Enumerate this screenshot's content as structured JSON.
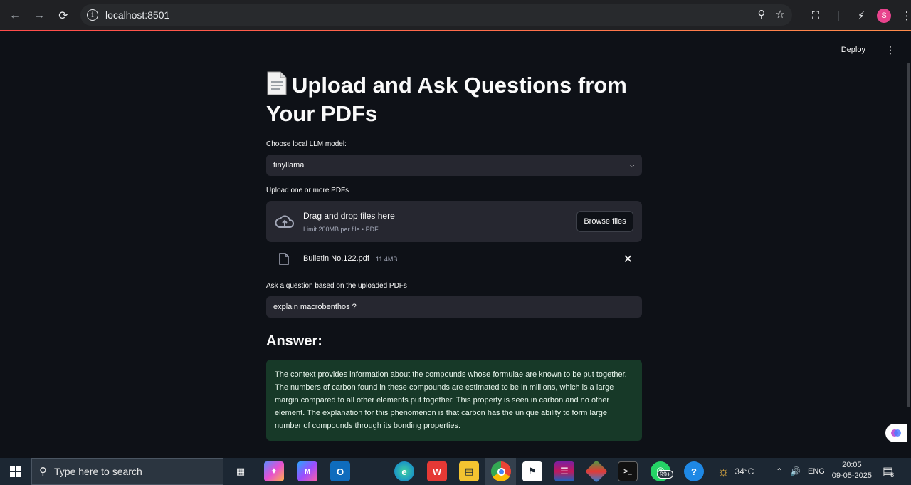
{
  "browser": {
    "url": "localhost:8501",
    "avatar_letter": "S",
    "icons": [
      "back-icon",
      "forward-icon",
      "reload-icon",
      "site-info-icon",
      "zoom-icon",
      "bookmark-star-icon",
      "extensions-icon",
      "performance-icon",
      "kebab-menu-icon"
    ]
  },
  "header": {
    "deploy_label": "Deploy",
    "menu_icon": "⋮"
  },
  "page": {
    "title_line1": "Upload and Ask Questions from",
    "title_line2": "Your PDFs",
    "model_label": "Choose local LLM model:",
    "model_value": "tinyllama",
    "upload_label": "Upload one or more PDFs",
    "dropzone_title": "Drag and drop files here",
    "dropzone_sub": "Limit 200MB per file • PDF",
    "browse_label": "Browse files",
    "uploaded_file": {
      "name": "Bulletin No.122.pdf",
      "size": "11.4MB"
    },
    "question_label": "Ask a question based on the uploaded PDFs",
    "question_value": "explain macrobenthos ?",
    "answer_heading": "Answer:",
    "answer_text": "The context provides information about the compounds whose formulae are known to be put together. The numbers of carbon found in these compounds are estimated to be in millions, which is a large margin compared to all other elements put together. This property is seen in carbon and no other element. The explanation for this phenomenon is that carbon has the unique ability to form large number of compounds through its bonding properties."
  },
  "taskbar": {
    "search_placeholder": "Type here to search",
    "whatsapp_badge": "99+",
    "weather": "34°C",
    "language": "ENG",
    "time": "20:05",
    "date": "09-05-2025",
    "notification_count": "8"
  },
  "colors": {
    "app_bg": "#0e1117",
    "widget_bg": "#262730",
    "answer_bg": "#173928",
    "accent": "#ff4b4b"
  }
}
